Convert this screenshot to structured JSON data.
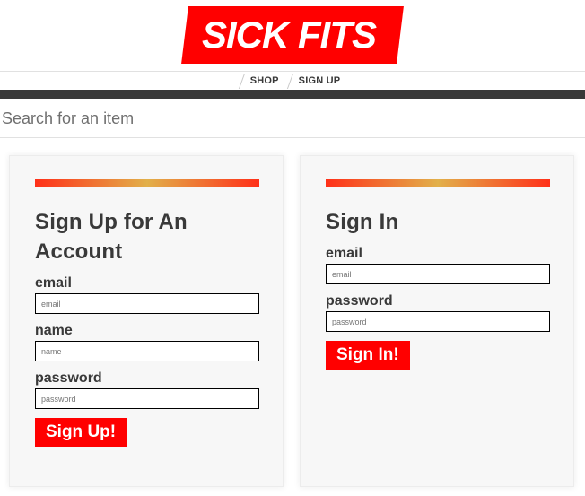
{
  "logo": {
    "text": "SICK FITS"
  },
  "nav": {
    "items": [
      {
        "label": "SHOP"
      },
      {
        "label": "SIGN UP"
      }
    ]
  },
  "search": {
    "placeholder": "Search for an item"
  },
  "signup": {
    "title": "Sign Up for An Account",
    "fields": [
      {
        "label": "email",
        "placeholder": "email",
        "value": ""
      },
      {
        "label": "name",
        "placeholder": "name",
        "value": ""
      },
      {
        "label": "password",
        "placeholder": "password",
        "value": ""
      }
    ],
    "button": "Sign Up!"
  },
  "signin": {
    "title": "Sign In",
    "fields": [
      {
        "label": "email",
        "placeholder": "email",
        "value": ""
      },
      {
        "label": "password",
        "placeholder": "password",
        "value": ""
      }
    ],
    "button": "Sign In!"
  },
  "colors": {
    "brand_red": "#ff0000",
    "text": "#393939",
    "nav_bar": "#393939",
    "card_bg": "#f7f7f7",
    "gradient_mid": "#e2b04a"
  }
}
